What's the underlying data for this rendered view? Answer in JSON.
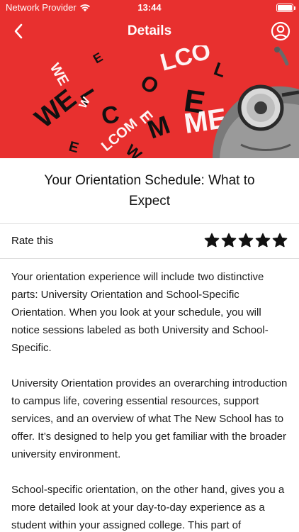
{
  "status_bar": {
    "carrier": "Network Provider",
    "time": "13:44",
    "battery_level": 1.0
  },
  "nav": {
    "title": "Details",
    "back_icon": "chevron-left-icon",
    "profile_icon": "user-circle-icon"
  },
  "hero": {
    "letters": [
      "WE",
      "LCOME",
      "W",
      "E",
      "L",
      "C",
      "O",
      "M",
      "E"
    ]
  },
  "article": {
    "title": "Your Orientation Schedule: What to Expect",
    "paragraphs": [
      "Your orientation experience will include two distinctive parts: University Orientation and School-Specific Orientation. When you look at your schedule, you will notice sessions labeled as both University and School-Specific.",
      "University Orientation provides an overarching introduction to campus life, covering essential resources, support services, and an overview of what The New School has to offer. It’s designed to help you get familiar with the broader university environment.",
      "School-specific orientation, on the other hand, gives you a more detailed look at your day-to-day experience as a student within your assigned college. This part of"
    ]
  },
  "rating": {
    "label": "Rate this",
    "stars": 5,
    "max_stars": 5
  },
  "colors": {
    "brand_red": "#e8302f",
    "text": "#111111",
    "divider": "#dcdcdc"
  }
}
